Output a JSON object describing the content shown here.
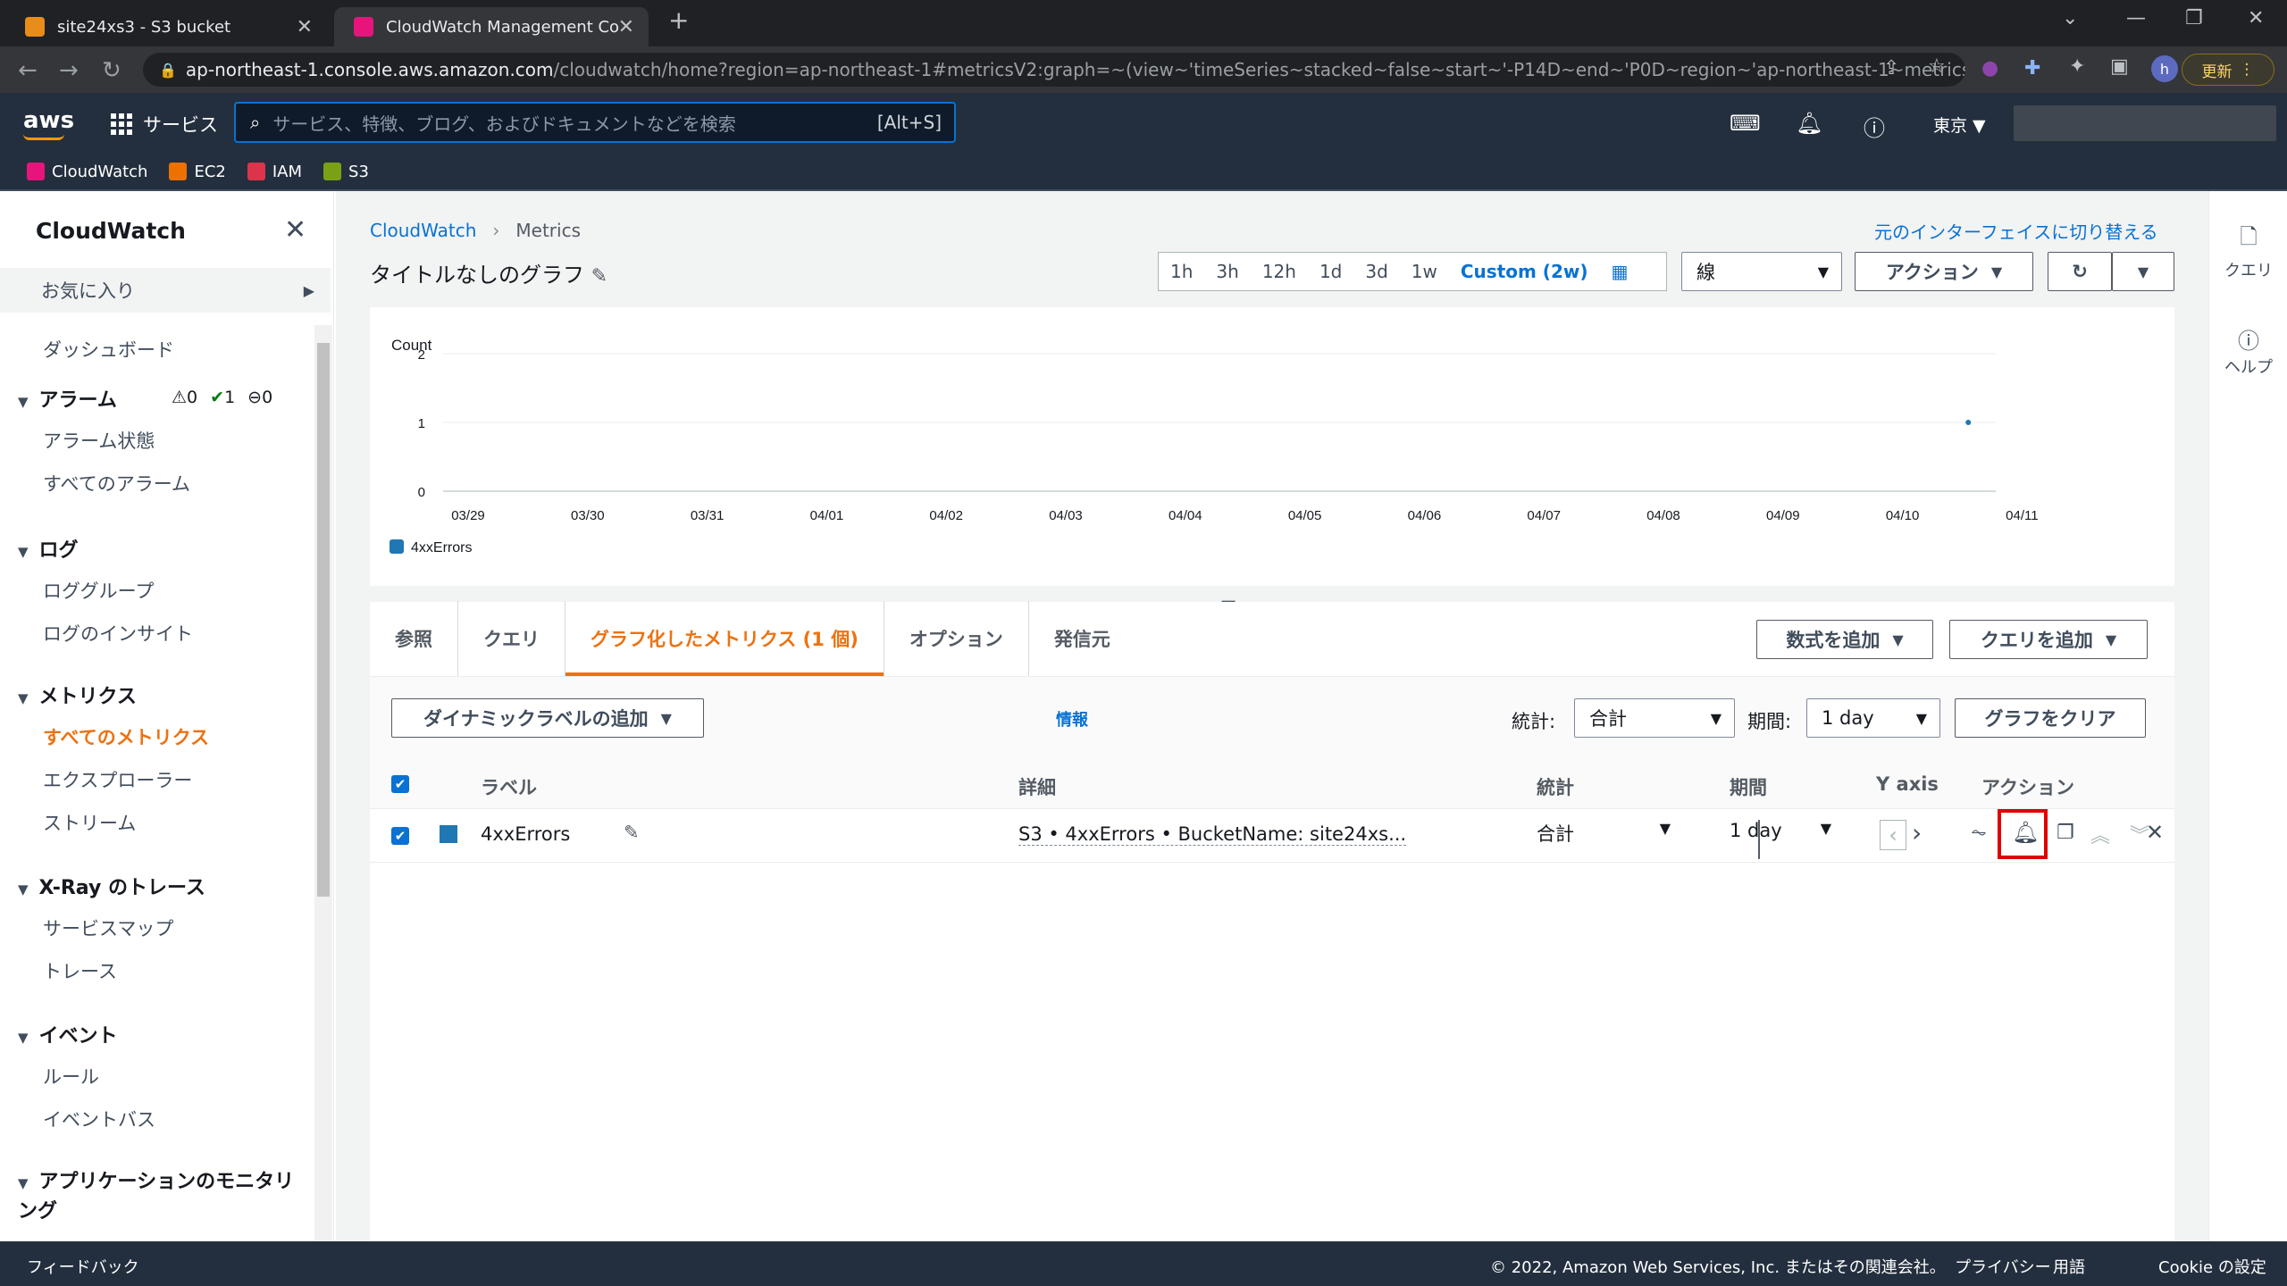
{
  "browser": {
    "tabs": [
      {
        "title": "site24xs3 - S3 bucket",
        "active": false
      },
      {
        "title": "CloudWatch Management Conso",
        "active": true
      }
    ],
    "url_host": "ap-northeast-1.console.aws.amazon.com",
    "url_path": "/cloudwatch/home?region=ap-northeast-1#metricsV2:graph=~(view~'timeSeries~stacked~false~start~'-P14D~end~'P0D~region~'ap-northeast-1~metrics~(~...",
    "update_label": "更新"
  },
  "aws_nav": {
    "logo": "aws",
    "services_label": "サービス",
    "search_placeholder": "サービス、特徴、ブログ、およびドキュメントなどを検索",
    "search_shortcut": "[Alt+S]",
    "region": "東京 ▼"
  },
  "favorites": [
    {
      "label": "CloudWatch",
      "color": "#e7157b"
    },
    {
      "label": "EC2",
      "color": "#ed7100"
    },
    {
      "label": "IAM",
      "color": "#dd344c"
    },
    {
      "label": "S3",
      "color": "#7aa116"
    }
  ],
  "sidebar": {
    "title": "CloudWatch",
    "favorites_label": "お気に入り",
    "dashboard": "ダッシュボード",
    "alarms": {
      "heading": "アラーム",
      "warn": "0",
      "ok": "1",
      "other": "0",
      "items": [
        "アラーム状態",
        "すべてのアラーム"
      ]
    },
    "logs": {
      "heading": "ログ",
      "items": [
        "ロググループ",
        "ログのインサイト"
      ]
    },
    "metrics": {
      "heading": "メトリクス",
      "items": [
        "すべてのメトリクス",
        "エクスプローラー",
        "ストリーム"
      ]
    },
    "xray": {
      "heading": "X-Ray のトレース",
      "items": [
        "サービスマップ",
        "トレース"
      ]
    },
    "events": {
      "heading": "イベント",
      "items": [
        "ルール",
        "イベントバス"
      ]
    },
    "appmon": {
      "heading": "アプリケーションのモニタリング"
    }
  },
  "right_rail": {
    "query": "クエリ",
    "help": "ヘルプ"
  },
  "main": {
    "breadcrumb_root": "CloudWatch",
    "breadcrumb_current": "Metrics",
    "switch_ui": "元のインターフェイスに切り替える",
    "graph_title": "タイトルなしのグラフ",
    "time_ranges": [
      "1h",
      "3h",
      "12h",
      "1d",
      "3d",
      "1w",
      "Custom (2w)"
    ],
    "chart_type": "線",
    "actions_label": "アクション"
  },
  "chart_data": {
    "type": "line",
    "ylabel": "Count",
    "ylim": [
      0,
      2
    ],
    "yticks": [
      "2",
      "1",
      "0"
    ],
    "x_ticks": [
      "03/29",
      "03/30",
      "03/31",
      "04/01",
      "04/02",
      "04/03",
      "04/04",
      "04/05",
      "04/06",
      "04/07",
      "04/08",
      "04/09",
      "04/10",
      "04/11"
    ],
    "series": [
      {
        "name": "4xxErrors",
        "color": "#1f77b4",
        "points": [
          {
            "x": "04/10",
            "y": 1
          }
        ]
      }
    ]
  },
  "bottom": {
    "tabs": [
      "参照",
      "クエリ",
      "グラフ化したメトリクス (1 個)",
      "オプション",
      "発信元"
    ],
    "add_math": "数式を追加",
    "add_query": "クエリを追加",
    "dyn_label": "ダイナミックラベルの追加",
    "info": "情報",
    "stat_label": "統計:",
    "stat_value": "合計",
    "period_label": "期間:",
    "period_value": "1 day",
    "clear_graph": "グラフをクリア",
    "columns": [
      "ラベル",
      "詳細",
      "統計",
      "期間",
      "Y axis",
      "アクション"
    ],
    "row": {
      "label": "4xxErrors",
      "detail": "S3 • 4xxErrors • BucketName: site24xs...",
      "stat": "合計",
      "period": "1 day",
      "color": "#1f77b4"
    }
  },
  "footer": {
    "feedback": "フィードバック",
    "copyright": "© 2022, Amazon Web Services, Inc. またはその関連会社。",
    "privacy": "プライバシー",
    "terms": "用語",
    "cookie": "Cookie の設定"
  }
}
